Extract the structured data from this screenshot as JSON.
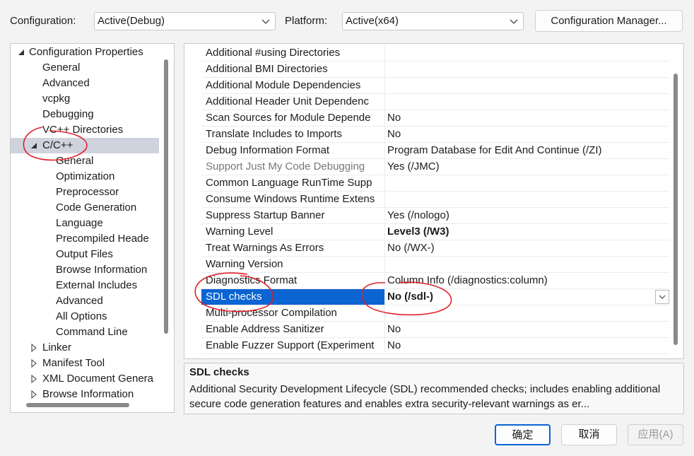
{
  "header": {
    "configuration_label": "Configuration:",
    "configuration_value": "Active(Debug)",
    "platform_label": "Platform:",
    "platform_value": "Active(x64)",
    "config_manager_button": "Configuration Manager..."
  },
  "tree": {
    "root": "Configuration Properties",
    "items": [
      {
        "label": "General"
      },
      {
        "label": "Advanced"
      },
      {
        "label": "vcpkg"
      },
      {
        "label": "Debugging"
      },
      {
        "label": "VC++ Directories"
      },
      {
        "label": "C/C++"
      },
      {
        "label": "General"
      },
      {
        "label": "Optimization"
      },
      {
        "label": "Preprocessor"
      },
      {
        "label": "Code Generation"
      },
      {
        "label": "Language"
      },
      {
        "label": "Precompiled Heade"
      },
      {
        "label": "Output Files"
      },
      {
        "label": "Browse Information"
      },
      {
        "label": "External Includes"
      },
      {
        "label": "Advanced"
      },
      {
        "label": "All Options"
      },
      {
        "label": "Command Line"
      },
      {
        "label": "Linker"
      },
      {
        "label": "Manifest Tool"
      },
      {
        "label": "XML Document Genera"
      },
      {
        "label": "Browse Information"
      }
    ]
  },
  "grid": {
    "rows": [
      {
        "name": "Additional #using Directories",
        "value": ""
      },
      {
        "name": "Additional BMI Directories",
        "value": ""
      },
      {
        "name": "Additional Module Dependencies",
        "value": ""
      },
      {
        "name": "Additional Header Unit Dependenc",
        "value": ""
      },
      {
        "name": "Scan Sources for Module Depende",
        "value": "No"
      },
      {
        "name": "Translate Includes to Imports",
        "value": "No"
      },
      {
        "name": "Debug Information Format",
        "value": "Program Database for Edit And Continue (/ZI)"
      },
      {
        "name": "Support Just My Code Debugging",
        "value": "Yes (/JMC)"
      },
      {
        "name": "Common Language RunTime Supp",
        "value": ""
      },
      {
        "name": "Consume Windows Runtime Extens",
        "value": ""
      },
      {
        "name": "Suppress Startup Banner",
        "value": "Yes (/nologo)"
      },
      {
        "name": "Warning Level",
        "value": "Level3 (/W3)"
      },
      {
        "name": "Treat Warnings As Errors",
        "value": "No (/WX-)"
      },
      {
        "name": "Warning Version",
        "value": ""
      },
      {
        "name": "Diagnostics Format",
        "value": "Column Info (/diagnostics:column)"
      },
      {
        "name": "SDL checks",
        "value": "No (/sdl-)"
      },
      {
        "name": "Multi-processor Compilation",
        "value": ""
      },
      {
        "name": "Enable Address Sanitizer",
        "value": "No"
      },
      {
        "name": "Enable Fuzzer Support (Experiment",
        "value": "No"
      }
    ]
  },
  "description": {
    "title": "SDL checks",
    "text": "Additional Security Development Lifecycle (SDL) recommended checks; includes enabling additional secure code generation features and enables extra security-relevant warnings as er..."
  },
  "buttons": {
    "ok": "确定",
    "cancel": "取消",
    "apply": "应用(A)"
  },
  "colors": {
    "selection": "#0a64d2",
    "tree_selection": "#cfd3dd",
    "annotation": "#e0202a"
  }
}
